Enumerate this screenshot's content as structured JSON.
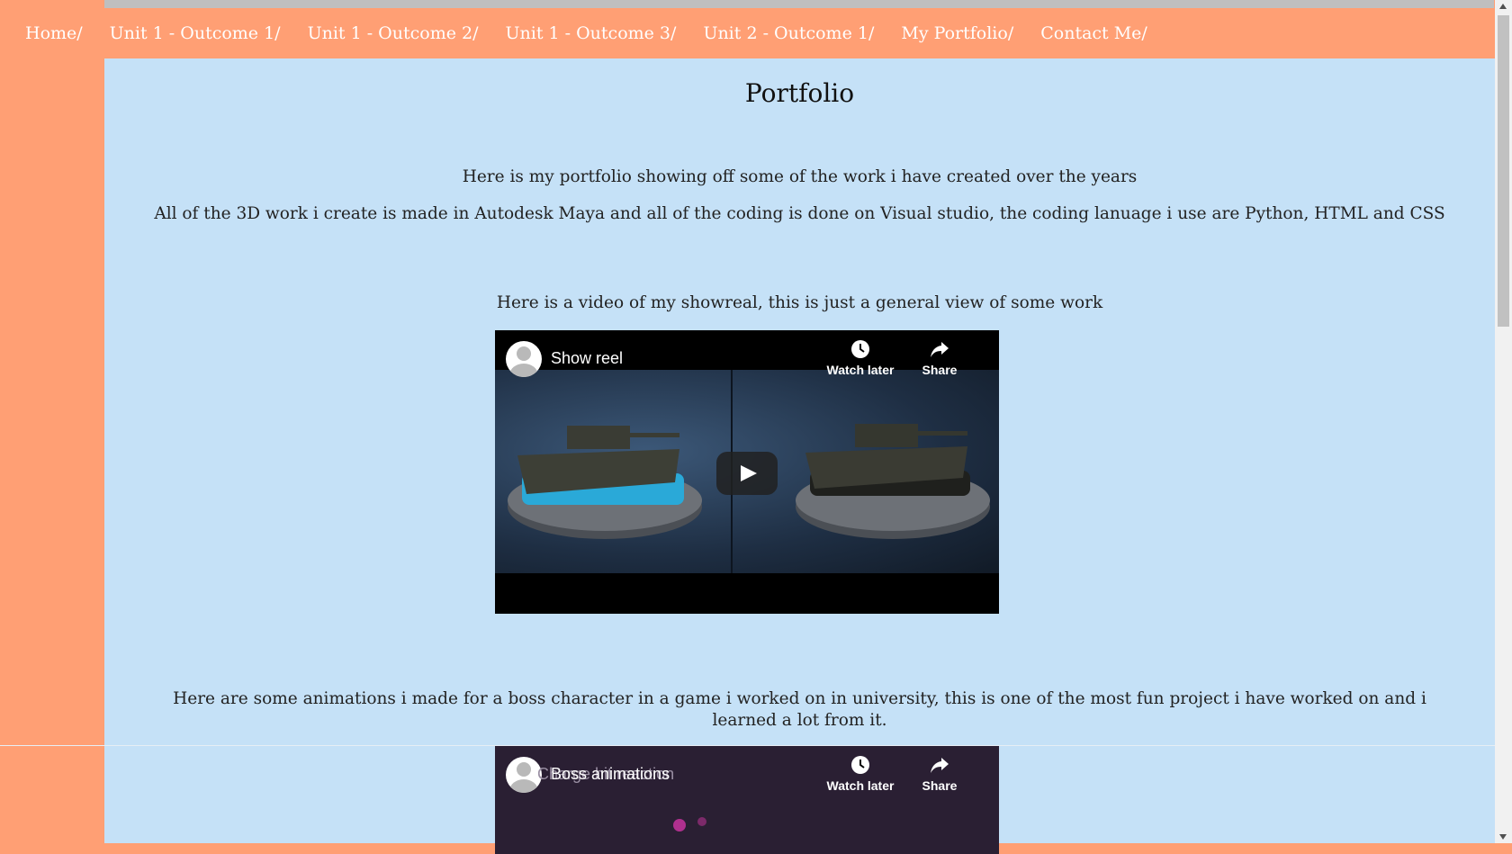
{
  "nav": {
    "items": [
      "Home/",
      "Unit 1 - Outcome 1/",
      "Unit 1 - Outcome 2/",
      "Unit 1 - Outcome 3/",
      "Unit 2 - Outcome 1/",
      "My Portfolio/",
      "Contact Me/"
    ]
  },
  "page": {
    "title": "Portfolio",
    "intro_1": "Here is my portfolio showing off some of the work i have created over the years",
    "intro_2": "All of the 3D work i create is made in Autodesk Maya and all of the coding is done on Visual studio, the coding lanuage i use are Python, HTML and CSS",
    "showreel_text": "Here is a video of my showreal, this is just a general view of some work",
    "boss_text": "Here are some animations i made for a boss character in a game i worked on in university, this is one of the most fun project i have worked on and i learned a lot from it."
  },
  "videos": [
    {
      "title": "Show reel",
      "watch_later": "Watch later",
      "share": "Share"
    },
    {
      "title": "Boss animations",
      "overlay_text": "Charge hit reaction",
      "watch_later": "Watch later",
      "share": "Share"
    }
  ],
  "colors": {
    "nav_bg": "#ff9f74",
    "content_bg": "#c5e1f7",
    "nav_text": "#ffffff"
  },
  "icons": [
    "clock-icon",
    "share-arrow-icon",
    "play-icon",
    "avatar-icon"
  ]
}
